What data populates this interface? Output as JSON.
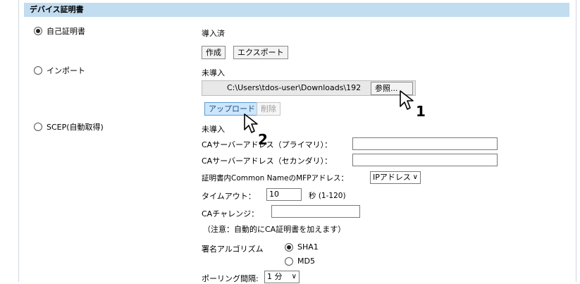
{
  "section": {
    "title": "デバイス証明書"
  },
  "options": {
    "self_cert": {
      "label": "自己証明書",
      "selected": true,
      "status": "導入済"
    },
    "import": {
      "label": "インポート",
      "selected": false,
      "status": "未導入"
    },
    "scep": {
      "label": "SCEP(自動取得)",
      "selected": false,
      "status": "未導入"
    }
  },
  "buttons": {
    "create": "作成",
    "export": "エクスポート",
    "browse": "参照...",
    "upload": "アップロード",
    "delete": "削除"
  },
  "file_path": "C:\\Users\\tdos-user\\Downloads\\192",
  "scep": {
    "ca_primary_label": "CAサーバーアドレス（プライマリ）：",
    "ca_secondary_label": "CAサーバーアドレス（セカンダリ）：",
    "mfp_address_label": "証明書内Common NameのMFPアドレス：",
    "mfp_address_value": "IPアドレス",
    "timeout_label": "タイムアウト：",
    "timeout_value": "10",
    "timeout_unit": "秒 (1-120)",
    "challenge_label": "CAチャレンジ：",
    "note": "（注意：自動的にCA証明書を加えます）",
    "sig_label": "署名アルゴリズム",
    "sig_sha1": "SHA1",
    "sig_md5": "MD5",
    "polling_label": "ポーリング間隔:",
    "polling_value": "1 分"
  },
  "steps": {
    "one": "1",
    "two": "2"
  },
  "icons": {
    "cursor": "mouse-pointer-icon",
    "chevron": "chevron-down-icon"
  }
}
